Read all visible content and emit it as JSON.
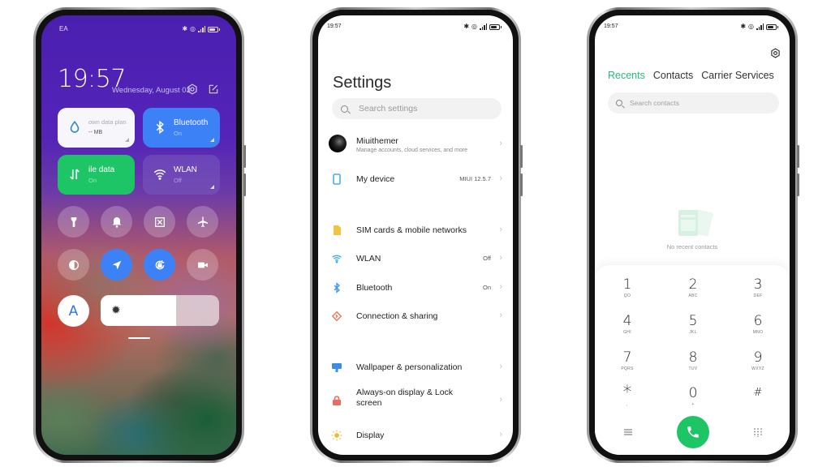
{
  "phone1": {
    "status_bar": {
      "carrier": "EA"
    },
    "clock": "19:57",
    "date": "Wednesday, August 03",
    "tiles": [
      {
        "id": "data-plan",
        "title": "own data plan",
        "sub": "-- MB",
        "icon": "water-drop-icon"
      },
      {
        "id": "bluetooth",
        "title": "Bluetooth",
        "sub": "On",
        "icon": "bluetooth-icon"
      },
      {
        "id": "mobile-data",
        "title": "ile data",
        "sub": "On",
        "icon": "data-arrows-icon"
      },
      {
        "id": "wlan",
        "title": "WLAN",
        "sub": "Off",
        "icon": "wifi-icon"
      }
    ],
    "toggles_row1": [
      "flashlight-icon",
      "bell-icon",
      "screenshot-icon",
      "airplane-icon"
    ],
    "toggles_row2": [
      "contrast-icon",
      "location-icon",
      "rotation-lock-icon",
      "video-camera-icon"
    ],
    "toggles_row2_on": [
      false,
      true,
      true,
      false
    ],
    "auto_brightness_label": "A",
    "brightness_percent": 64,
    "colors": {
      "accent_blue": "#3c82f6",
      "accent_green": "#1ec567"
    }
  },
  "phone2": {
    "status_bar": {
      "time": "19:57"
    },
    "title": "Settings",
    "search_placeholder": "Search settings",
    "account": {
      "name": "Miuithemer",
      "sub": "Manage accounts, cloud services, and more"
    },
    "items": [
      {
        "label": "My device",
        "value": "MIUI 12.5.7",
        "icon": "phone-outline-icon"
      },
      {
        "label": "SIM cards & mobile networks",
        "value": "",
        "icon": "sim-card-icon"
      },
      {
        "label": "WLAN",
        "value": "Off",
        "icon": "wifi-icon"
      },
      {
        "label": "Bluetooth",
        "value": "On",
        "icon": "bluetooth-icon"
      },
      {
        "label": "Connection & sharing",
        "value": "",
        "icon": "connection-sharing-icon"
      },
      {
        "label": "Wallpaper & personalization",
        "value": "",
        "icon": "wallpaper-icon"
      },
      {
        "label": "Always-on display & Lock screen",
        "value": "",
        "icon": "lock-icon"
      },
      {
        "label": "Display",
        "value": "",
        "icon": "sun-icon"
      }
    ]
  },
  "phone3": {
    "status_bar": {
      "time": "19:57"
    },
    "tabs": [
      "Recents",
      "Contacts",
      "Carrier Services"
    ],
    "active_tab": "Recents",
    "search_placeholder": "Search contacts",
    "empty_text": "No recent contacts",
    "keys": [
      {
        "digit": "1",
        "letters": "QO"
      },
      {
        "digit": "2",
        "letters": "ABC"
      },
      {
        "digit": "3",
        "letters": "DEF"
      },
      {
        "digit": "4",
        "letters": "GHI"
      },
      {
        "digit": "5",
        "letters": "JKL"
      },
      {
        "digit": "6",
        "letters": "MNO"
      },
      {
        "digit": "7",
        "letters": "PQRS"
      },
      {
        "digit": "8",
        "letters": "TUV"
      },
      {
        "digit": "9",
        "letters": "WXYZ"
      },
      {
        "digit": "*",
        "letters": ","
      },
      {
        "digit": "0",
        "letters": "+"
      },
      {
        "digit": "#",
        "letters": ""
      }
    ],
    "colors": {
      "accent_green": "#28b878",
      "call_green": "#1ec564"
    }
  }
}
